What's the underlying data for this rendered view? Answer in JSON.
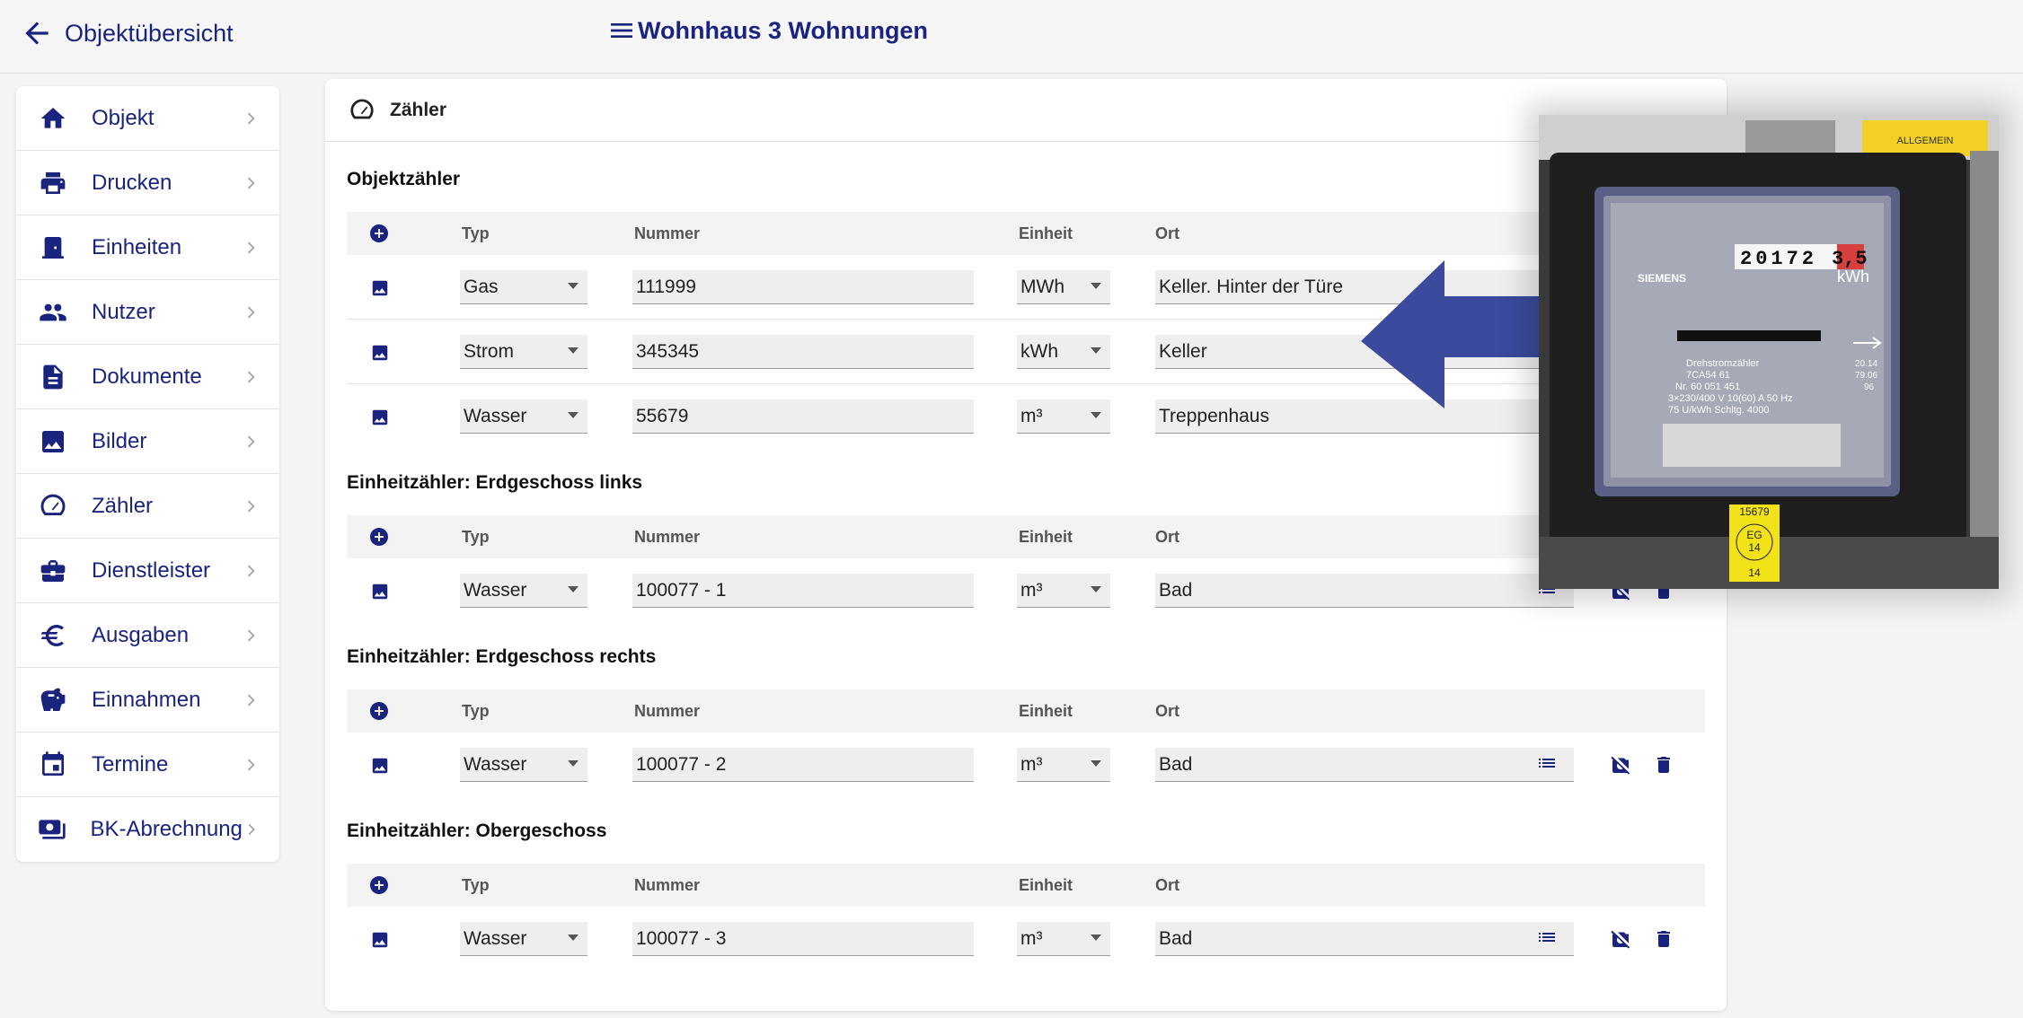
{
  "topbar": {
    "back_label": "Objektübersicht",
    "title": "Wohnhaus 3 Wohnungen"
  },
  "sidebar": {
    "items": [
      {
        "label": "Objekt",
        "icon": "home-icon"
      },
      {
        "label": "Drucken",
        "icon": "printer-icon"
      },
      {
        "label": "Einheiten",
        "icon": "door-icon"
      },
      {
        "label": "Nutzer",
        "icon": "people-icon"
      },
      {
        "label": "Dokumente",
        "icon": "document-icon"
      },
      {
        "label": "Bilder",
        "icon": "image-icon"
      },
      {
        "label": "Zähler",
        "icon": "speedometer-icon"
      },
      {
        "label": "Dienstleister",
        "icon": "briefcase-icon"
      },
      {
        "label": "Ausgaben",
        "icon": "euro-icon"
      },
      {
        "label": "Einnahmen",
        "icon": "piggy-bank-icon"
      },
      {
        "label": "Termine",
        "icon": "calendar-icon"
      },
      {
        "label": "BK-Abrechnung",
        "icon": "billing-icon"
      }
    ]
  },
  "card": {
    "title": "Zähler"
  },
  "columns": {
    "typ": "Typ",
    "nummer": "Nummer",
    "einheit": "Einheit",
    "ort": "Ort"
  },
  "sections": [
    {
      "title": "Objektzähler",
      "rows": [
        {
          "typ": "Gas",
          "nummer": "111999",
          "einheit": "MWh",
          "ort": "Keller. Hinter der Türe"
        },
        {
          "typ": "Strom",
          "nummer": "345345",
          "einheit": "kWh",
          "ort": "Keller"
        },
        {
          "typ": "Wasser",
          "nummer": "55679",
          "einheit": "m³",
          "ort": "Treppenhaus"
        }
      ]
    },
    {
      "title": "Einheitzähler: Erdgeschoss links",
      "rows": [
        {
          "typ": "Wasser",
          "nummer": "100077 - 1",
          "einheit": "m³",
          "ort": "Bad"
        }
      ]
    },
    {
      "title": "Einheitzähler: Erdgeschoss rechts",
      "rows": [
        {
          "typ": "Wasser",
          "nummer": "100077 - 2",
          "einheit": "m³",
          "ort": "Bad"
        }
      ]
    },
    {
      "title": "Einheitzähler: Obergeschoss",
      "rows": [
        {
          "typ": "Wasser",
          "nummer": "100077 - 3",
          "einheit": "m³",
          "ort": "Bad"
        }
      ]
    }
  ],
  "photo": {
    "label_allgemein": "ALLGEMEIN",
    "brand": "SIEMENS",
    "counter": "20172",
    "counter_tail": "3,5",
    "unit": "kWh",
    "title_line": "Drehstromzähler",
    "model": "7CA54 61",
    "serial": "Nr.  60 051 451",
    "spec1": "3×230/400 V    10(60) A    50 Hz",
    "spec2": "75 U/kWh        Schltg. 4000",
    "date1": "20.14",
    "date2": "79.06",
    "num96": "96",
    "sticker_top": "15679",
    "sticker_mid1": "EG",
    "sticker_mid2": "14",
    "sticker_bottom": "14"
  },
  "colors": {
    "primary": "#1a237e",
    "arrow": "#3b4a9c"
  }
}
